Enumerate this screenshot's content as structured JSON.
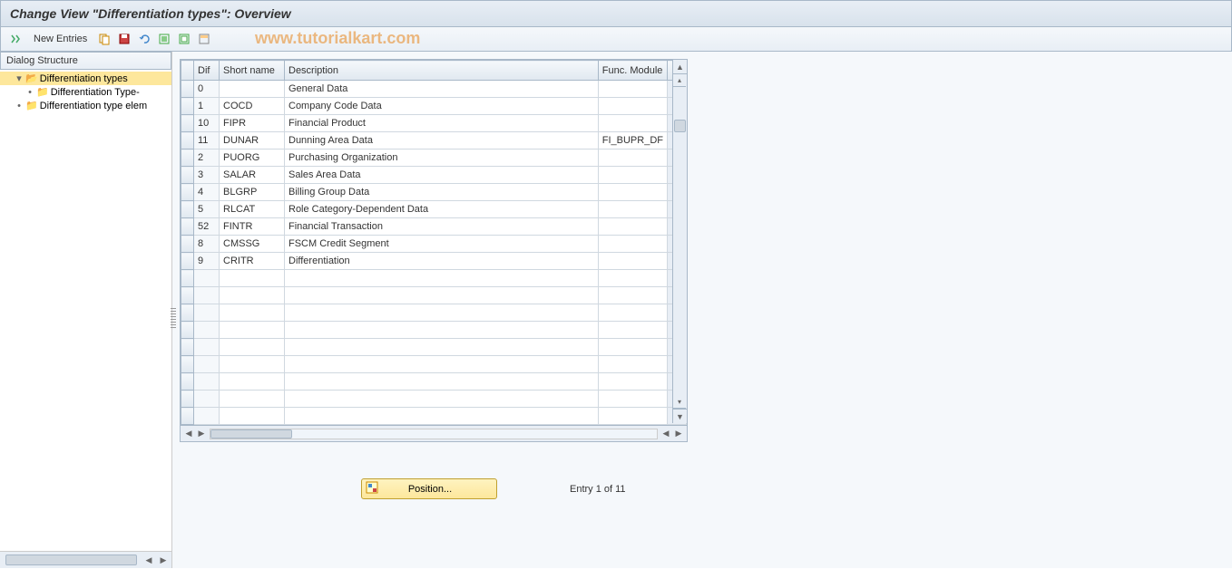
{
  "title": "Change View \"Differentiation types\": Overview",
  "watermark": "www.tutorialkart.com",
  "toolbar": {
    "new_entries_label": "New Entries"
  },
  "sidebar": {
    "header": "Dialog Structure",
    "items": [
      {
        "label": "Differentiation types",
        "selected": true,
        "open": true,
        "indent": 1,
        "expand": "▾"
      },
      {
        "label": "Differentiation Type-",
        "selected": false,
        "open": false,
        "indent": 2,
        "expand": "•"
      },
      {
        "label": "Differentiation type elem",
        "selected": false,
        "open": false,
        "indent": 1,
        "expand": "•"
      }
    ]
  },
  "table": {
    "columns": {
      "dif": "Dif",
      "short": "Short name",
      "desc": "Description",
      "func": "Func. Module"
    },
    "rows": [
      {
        "dif": "0",
        "short": "",
        "desc": "General Data",
        "func": ""
      },
      {
        "dif": "1",
        "short": "COCD",
        "desc": "Company Code Data",
        "func": ""
      },
      {
        "dif": "10",
        "short": "FIPR",
        "desc": "Financial Product",
        "func": ""
      },
      {
        "dif": "11",
        "short": "DUNAR",
        "desc": "Dunning Area Data",
        "func": "FI_BUPR_DF"
      },
      {
        "dif": "2",
        "short": "PUORG",
        "desc": "Purchasing Organization",
        "func": ""
      },
      {
        "dif": "3",
        "short": "SALAR",
        "desc": "Sales Area Data",
        "func": ""
      },
      {
        "dif": "4",
        "short": "BLGRP",
        "desc": "Billing Group Data",
        "func": ""
      },
      {
        "dif": "5",
        "short": "RLCAT",
        "desc": "Role Category-Dependent Data",
        "func": ""
      },
      {
        "dif": "52",
        "short": "FINTR",
        "desc": "Financial Transaction",
        "func": ""
      },
      {
        "dif": "8",
        "short": "CMSSG",
        "desc": "FSCM Credit Segment",
        "func": ""
      },
      {
        "dif": "9",
        "short": "CRITR",
        "desc": "Differentiation",
        "func": ""
      }
    ],
    "empty_rows": 9
  },
  "footer": {
    "position_label": "Position...",
    "entry_label": "Entry 1 of 11"
  }
}
